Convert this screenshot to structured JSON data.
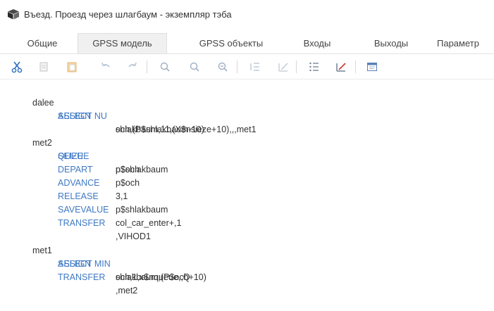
{
  "window": {
    "title": "Въезд. Проезд через шлагбаум - экземпляр тэба",
    "icon": "app-cube-icon"
  },
  "tabs": [
    {
      "label": "Общие"
    },
    {
      "label": "GPSS модель",
      "active": true
    },
    {
      "label": "GPSS объекты"
    },
    {
      "label": "Входы"
    },
    {
      "label": "Выходы"
    },
    {
      "label": "Параметр"
    }
  ],
  "toolbar": {
    "buttons": [
      "cut-icon",
      "copy-icon",
      "paste-icon",
      "undo-icon",
      "redo-icon",
      "zoom-in-icon",
      "zoom-icon",
      "zoom-out-icon",
      "indent-icon",
      "uncheck-icon",
      "list-icon",
      "uncheck-red-icon",
      "window-icon"
    ]
  },
  "code": [
    {
      "label": "dalee",
      "keyword": "SELECT NU",
      "args": "shlakbaum,11,(X$nsieze+10),,,met1"
    },
    {
      "label": "",
      "keyword": "ASSIGN",
      "args": "och,(P$shlakbaum-10)"
    },
    {
      "label": "",
      "keyword": "",
      "args": ""
    },
    {
      "label": "met2",
      "keyword": "QUEUE",
      "args": "p$och"
    },
    {
      "label": "",
      "keyword": "SEIZE",
      "args": "p$shlakbaum"
    },
    {
      "label": "",
      "keyword": "DEPART",
      "args": "p$och"
    },
    {
      "label": "",
      "keyword": "ADVANCE",
      "args": "3,1"
    },
    {
      "label": "",
      "keyword": "RELEASE",
      "args": "p$shlakbaum"
    },
    {
      "label": "",
      "keyword": "SAVEVALUE",
      "args": "col_car_enter+,1"
    },
    {
      "label": "",
      "keyword": "TRANSFER",
      "args": ",VIHOD1"
    },
    {
      "label": "",
      "keyword": "",
      "args": ""
    },
    {
      "label": "met1",
      "keyword": "SELECT MIN",
      "args": "och,1,x$nqueue,,Q"
    },
    {
      "label": "",
      "keyword": "ASSIGN",
      "args": "shlakbaum,(P$och+10)"
    },
    {
      "label": "",
      "keyword": "TRANSFER",
      "args": ",met2"
    }
  ],
  "colors": {
    "keyword": "#3f79c5",
    "text": "#333333"
  }
}
